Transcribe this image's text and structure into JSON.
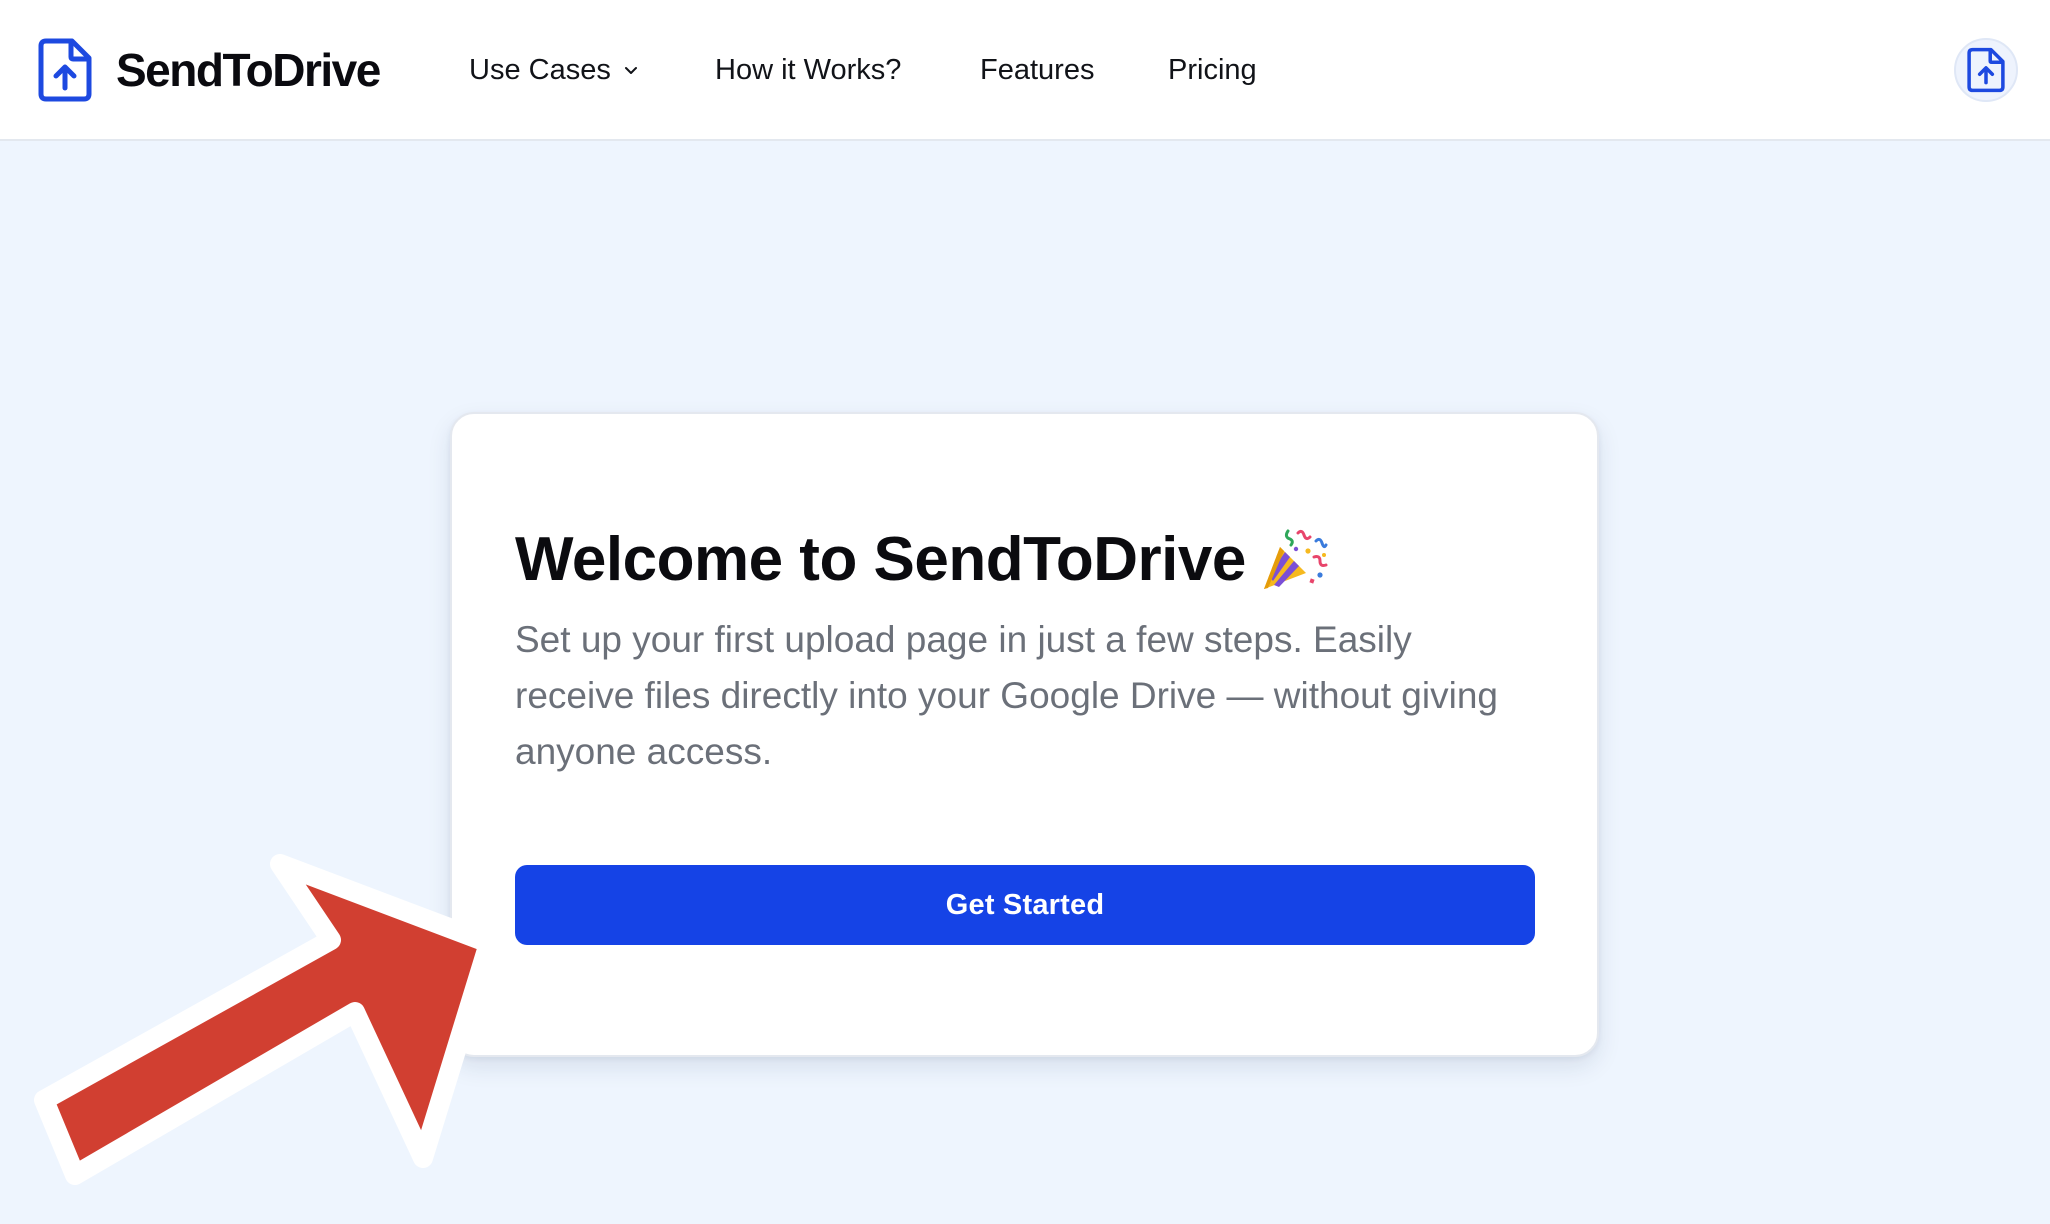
{
  "brand": {
    "name": "SendToDrive"
  },
  "nav": {
    "use_cases": "Use Cases",
    "how_it_works": "How it Works?",
    "features": "Features",
    "pricing": "Pricing"
  },
  "welcome_card": {
    "title": "Welcome to SendToDrive",
    "title_emoji": "party-popper-icon",
    "description": "Set up your first upload page in just a few steps. Easily receive files directly into your Google Drive — without giving anyone access.",
    "cta_label": "Get Started"
  },
  "colors": {
    "primary": "#1543e6",
    "page_background": "#eef5fe",
    "annotation_arrow": "#d13f31"
  },
  "icons": {
    "brand_logo": "file-upload-icon",
    "account": "file-upload-icon",
    "dropdown": "chevron-down-icon"
  }
}
